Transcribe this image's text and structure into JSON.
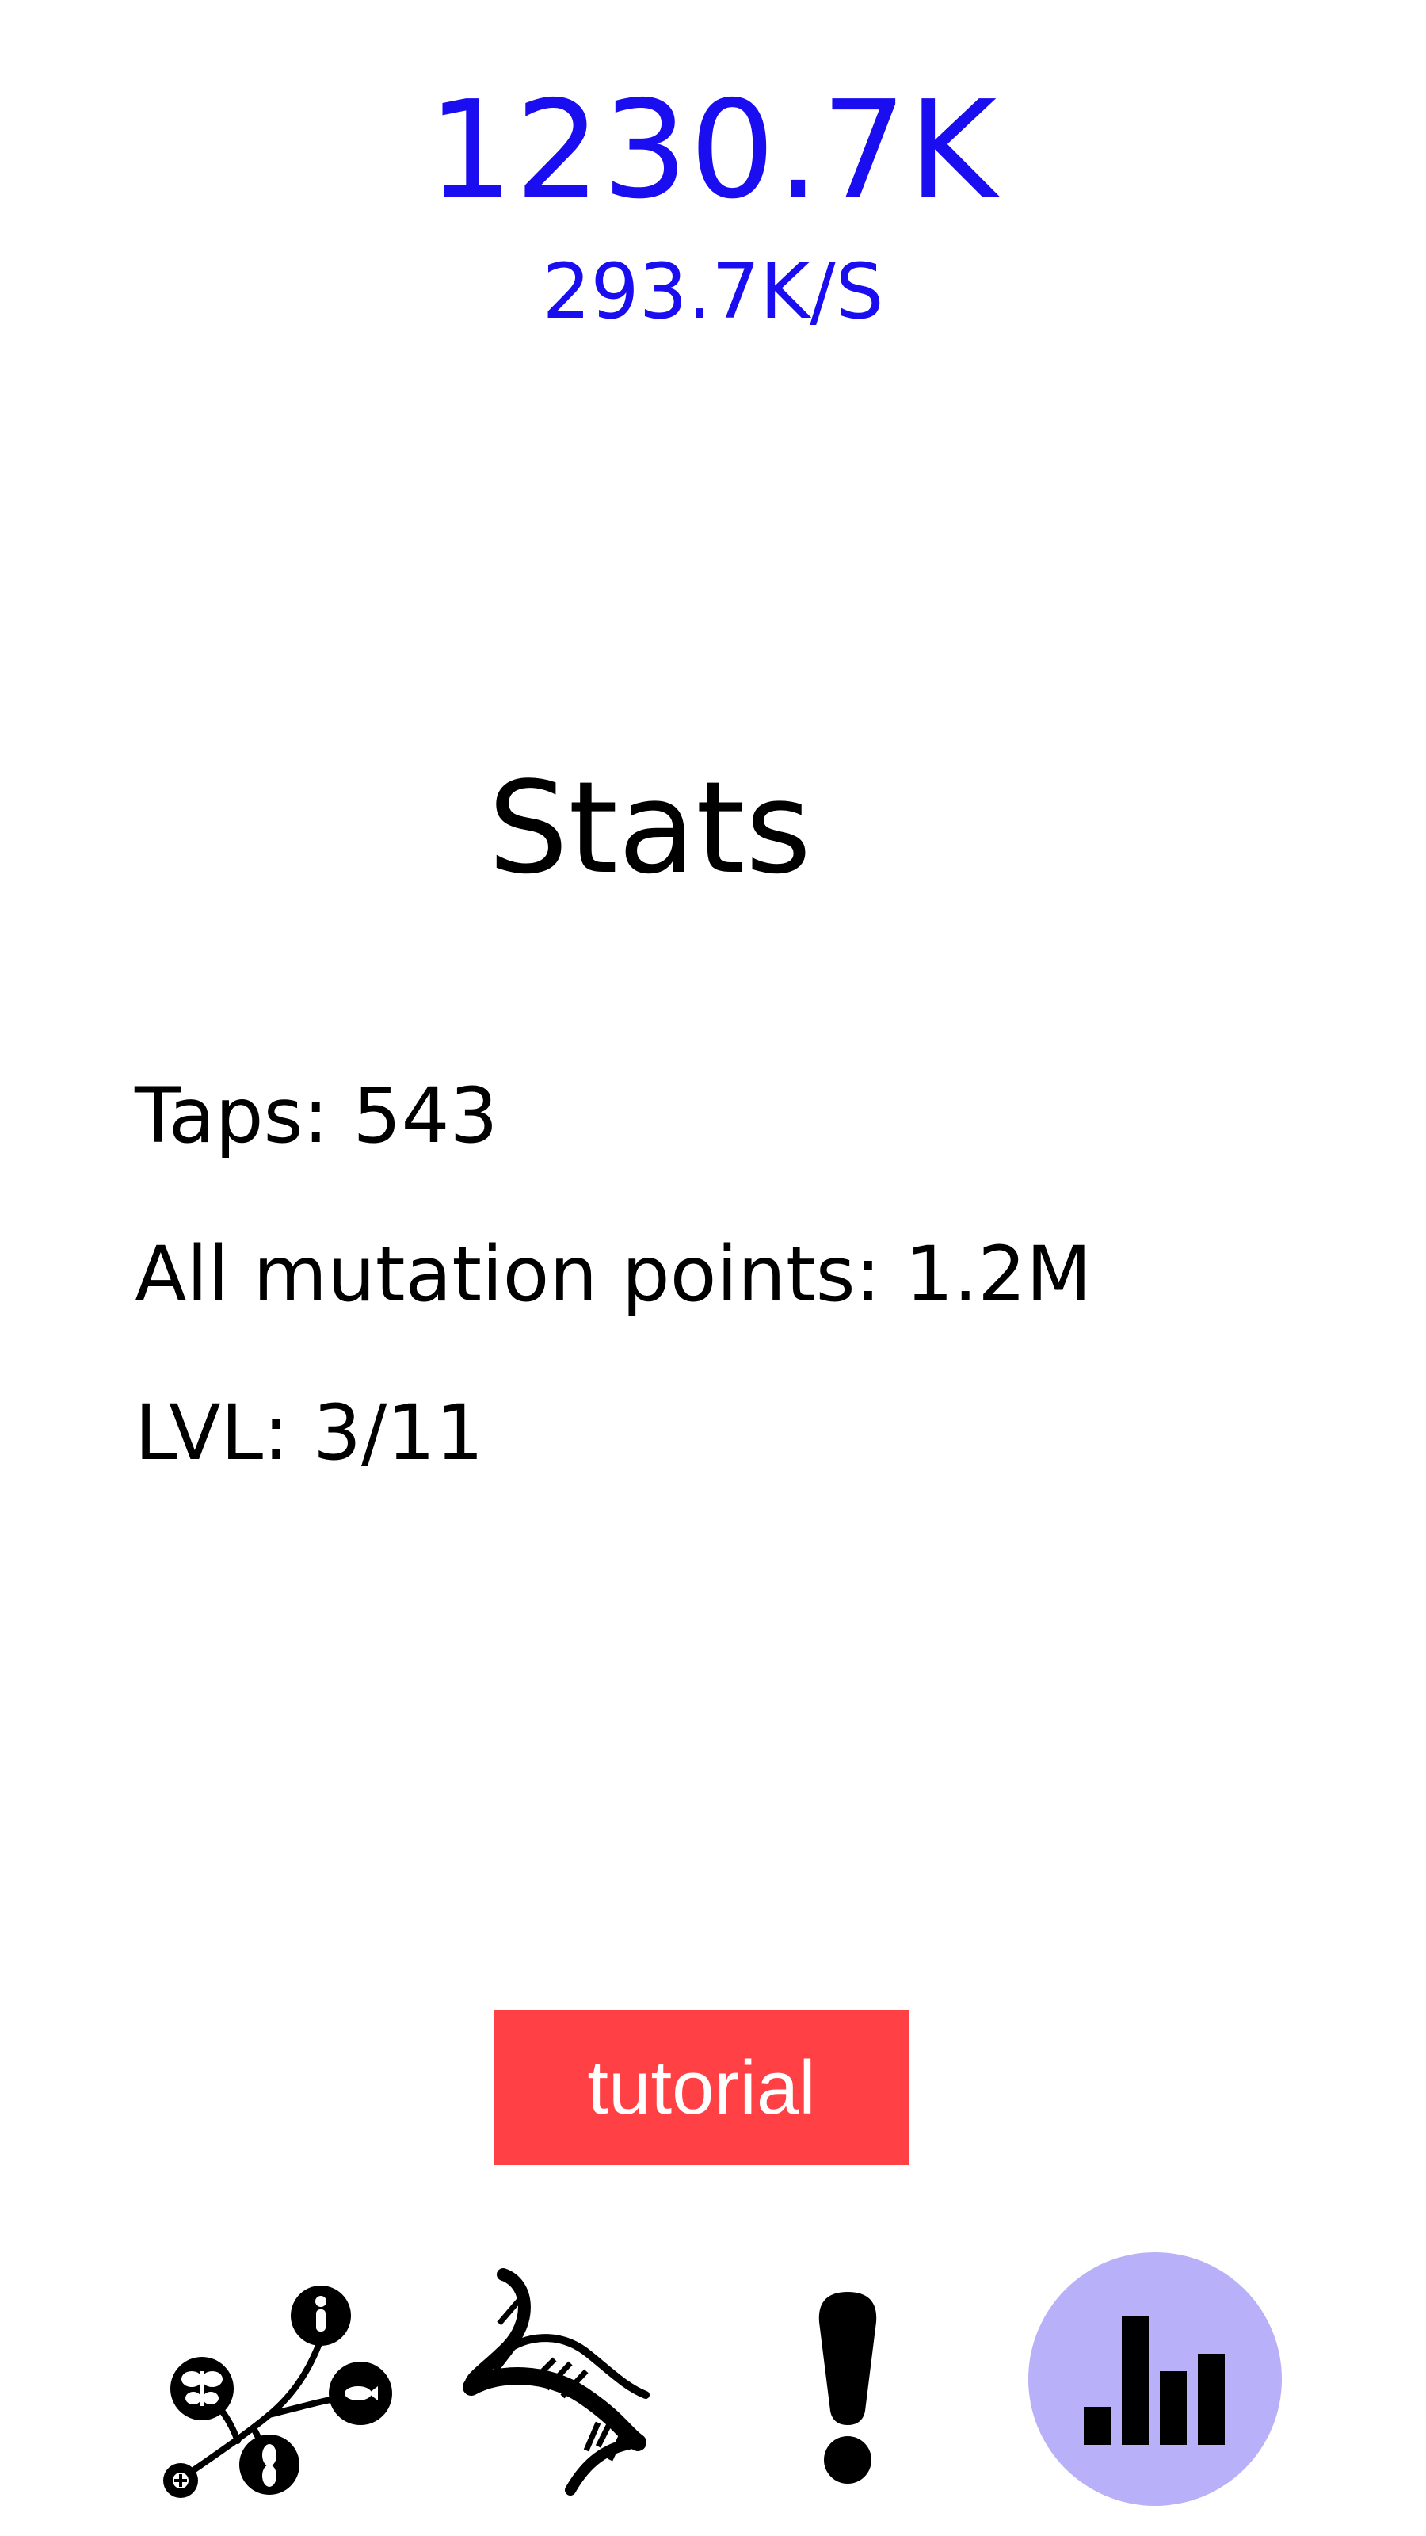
{
  "header": {
    "points": "1230.7K",
    "rate": "293.7K/S",
    "accent_color": "#1a0df0"
  },
  "stats": {
    "title": "Stats",
    "taps": "Taps: 543",
    "mutation_points": "All mutation points: 1.2M",
    "level": "LVL: 3/11"
  },
  "tutorial": {
    "label": "tutorial",
    "color": "#ff4044"
  },
  "nav": {
    "items": [
      {
        "icon": "evolution-tree-icon",
        "active": false
      },
      {
        "icon": "dna-icon",
        "active": false
      },
      {
        "icon": "exclamation-icon",
        "active": false
      },
      {
        "icon": "bar-chart-icon",
        "active": true
      }
    ],
    "active_color": "#b8b0f8"
  }
}
